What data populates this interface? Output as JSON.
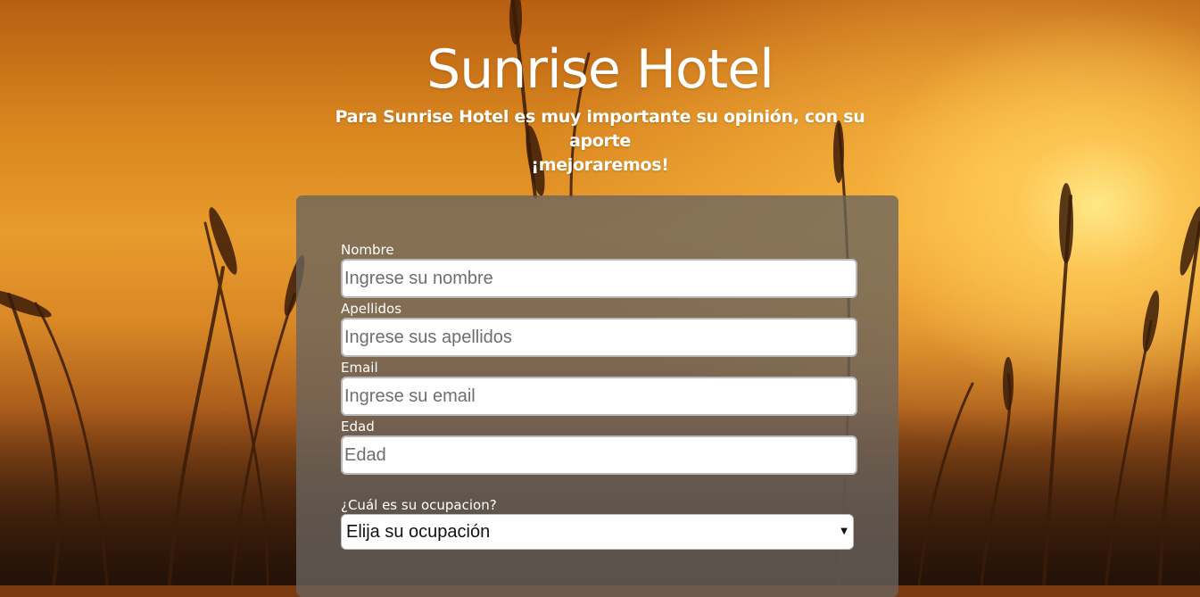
{
  "header": {
    "title": "Sunrise Hotel",
    "subtitle_line1": "Para Sunrise Hotel es muy importante su opinión, con su aporte",
    "subtitle_line2": "¡mejoraremos!"
  },
  "form": {
    "fields": [
      {
        "label": "Nombre",
        "placeholder": "Ingrese su nombre",
        "value": ""
      },
      {
        "label": "Apellidos",
        "placeholder": "Ingrese sus apellidos",
        "value": ""
      },
      {
        "label": "Email",
        "placeholder": "Ingrese su email",
        "value": ""
      },
      {
        "label": "Edad",
        "placeholder": "Edad",
        "value": ""
      }
    ],
    "occupation": {
      "label": "¿Cuál es su ocupacion?",
      "selected": "Elija su ocupación",
      "arrow_icon": "chevron-down-icon"
    }
  },
  "colors": {
    "background_sunset": "#e89b2c",
    "panel_overlay": "#69645f",
    "text": "#ffffff"
  }
}
